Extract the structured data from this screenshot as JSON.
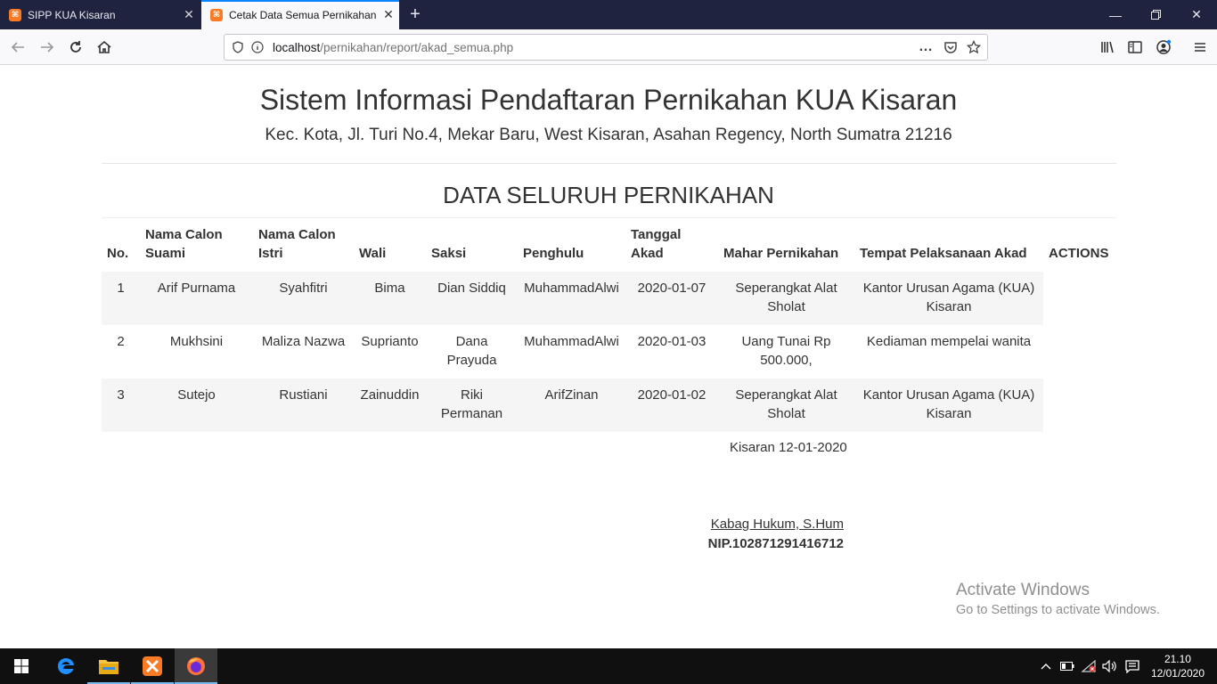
{
  "browser": {
    "tabs": [
      {
        "title": "SIPP KUA Kisaran",
        "favicon": "xampp-icon",
        "active": false
      },
      {
        "title": "Cetak Data Semua Pernikahan",
        "favicon": "xampp-icon",
        "active": true
      }
    ],
    "url_host": "localhost",
    "url_path": "/pernikahan/report/akad_semua.php"
  },
  "header": {
    "title": "Sistem Informasi Pendaftaran Pernikahan KUA Kisaran",
    "address": "Kec. Kota, Jl. Turi No.4, Mekar Baru, West Kisaran, Asahan Regency, North Sumatra 21216"
  },
  "report": {
    "title": "DATA SELURUH PERNIKAHAN",
    "columns": [
      {
        "line1": "",
        "line2": "No."
      },
      {
        "line1": "Nama Calon",
        "line2": "Suami"
      },
      {
        "line1": "Nama Calon",
        "line2": "Istri"
      },
      {
        "line1": "",
        "line2": "Wali"
      },
      {
        "line1": "",
        "line2": "Saksi"
      },
      {
        "line1": "",
        "line2": "Penghulu"
      },
      {
        "line1": "Tanggal",
        "line2": "Akad"
      },
      {
        "line1": "",
        "line2": "Mahar Pernikahan"
      },
      {
        "line1": "",
        "line2": "Tempat Pelaksanaan Akad"
      },
      {
        "line1": "",
        "line2": "ACTIONS"
      }
    ],
    "rows": [
      {
        "no": "1",
        "suami": "Arif Purnama",
        "istri": "Syahfitri",
        "wali": "Bima",
        "saksi": "Dian Siddiq",
        "penghulu": "MuhammadAlwi",
        "tanggal": "2020-01-07",
        "mahar": "Seperangkat Alat Sholat",
        "tempat": "Kantor Urusan Agama (KUA) Kisaran"
      },
      {
        "no": "2",
        "suami": "Mukhsini",
        "istri": "Maliza Nazwa",
        "wali": "Suprianto",
        "saksi": "Dana Prayuda",
        "penghulu": "MuhammadAlwi",
        "tanggal": "2020-01-03",
        "mahar": "Uang Tunai Rp 500.000,",
        "tempat": "Kediaman mempelai wanita"
      },
      {
        "no": "3",
        "suami": "Sutejo",
        "istri": "Rustiani",
        "wali": "Zainuddin",
        "saksi": "Riki Permanan",
        "penghulu": "ArifZinan",
        "tanggal": "2020-01-02",
        "mahar": "Seperangkat Alat Sholat",
        "tempat": "Kantor Urusan Agama (KUA) Kisaran"
      }
    ]
  },
  "signature": {
    "place_date": "Kisaran 12-01-2020",
    "name": "Kabag Hukum, S.Hum",
    "nip": "NIP.102871291416712"
  },
  "watermark": {
    "line1": "Activate Windows",
    "line2": "Go to Settings to activate Windows."
  },
  "taskbar": {
    "time": "21.10",
    "date": "12/01/2020"
  },
  "colors": {
    "tabbar": "#202340",
    "accent": "#0a84ff",
    "xampp": "#fb7a24",
    "row_stripe": "#f5f5f5"
  }
}
